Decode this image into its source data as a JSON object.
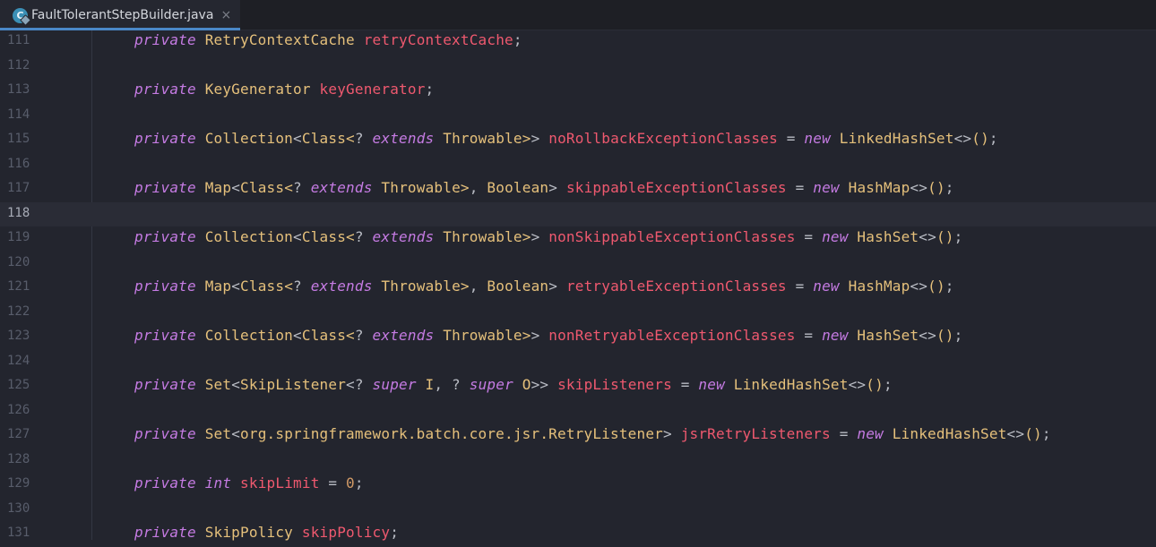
{
  "tab": {
    "title": "FaultTolerantStepBuilder.java",
    "close": "×",
    "icon_letter": "C"
  },
  "colors": {
    "keyword": "#c57be3",
    "type": "#e5c07b",
    "field": "#ef596f",
    "number": "#d19a66",
    "punct": "#b9bcc4",
    "background": "#23252e"
  },
  "editor": {
    "current_line": "118",
    "lines": [
      {
        "no": "111",
        "tokens": [
          [
            "kw",
            "private"
          ],
          [
            "pn",
            " "
          ],
          [
            "ty",
            "RetryContextCache"
          ],
          [
            "pn",
            " "
          ],
          [
            "fd",
            "retryContextCache"
          ],
          [
            "pn",
            ";"
          ]
        ]
      },
      {
        "no": "112",
        "tokens": []
      },
      {
        "no": "113",
        "tokens": [
          [
            "kw",
            "private"
          ],
          [
            "pn",
            " "
          ],
          [
            "ty",
            "KeyGenerator"
          ],
          [
            "pn",
            " "
          ],
          [
            "fd",
            "keyGenerator"
          ],
          [
            "pn",
            ";"
          ]
        ]
      },
      {
        "no": "114",
        "tokens": []
      },
      {
        "no": "115",
        "tokens": [
          [
            "kw",
            "private"
          ],
          [
            "pn",
            " "
          ],
          [
            "ty",
            "Collection"
          ],
          [
            "pn",
            "<"
          ],
          [
            "ty",
            "Class"
          ],
          [
            "gn",
            "<"
          ],
          [
            "pn",
            "? "
          ],
          [
            "kw",
            "extends"
          ],
          [
            "pn",
            " "
          ],
          [
            "ty",
            "Throwable"
          ],
          [
            "gn",
            ">"
          ],
          [
            "pn",
            "> "
          ],
          [
            "fd",
            "noRollbackExceptionClasses"
          ],
          [
            "pn",
            " = "
          ],
          [
            "kw",
            "new"
          ],
          [
            "pn",
            " "
          ],
          [
            "ty",
            "LinkedHashSet"
          ],
          [
            "pn",
            "<>"
          ],
          [
            "br",
            "()"
          ],
          [
            "pn",
            ";"
          ]
        ]
      },
      {
        "no": "116",
        "tokens": []
      },
      {
        "no": "117",
        "tokens": [
          [
            "kw",
            "private"
          ],
          [
            "pn",
            " "
          ],
          [
            "ty",
            "Map"
          ],
          [
            "pn",
            "<"
          ],
          [
            "ty",
            "Class"
          ],
          [
            "gn",
            "<"
          ],
          [
            "pn",
            "? "
          ],
          [
            "kw",
            "extends"
          ],
          [
            "pn",
            " "
          ],
          [
            "ty",
            "Throwable"
          ],
          [
            "gn",
            ">"
          ],
          [
            "pn",
            ", "
          ],
          [
            "ty",
            "Boolean"
          ],
          [
            "pn",
            "> "
          ],
          [
            "fd",
            "skippableExceptionClasses"
          ],
          [
            "pn",
            " = "
          ],
          [
            "kw",
            "new"
          ],
          [
            "pn",
            " "
          ],
          [
            "ty",
            "HashMap"
          ],
          [
            "pn",
            "<>"
          ],
          [
            "br",
            "()"
          ],
          [
            "pn",
            ";"
          ]
        ]
      },
      {
        "no": "118",
        "tokens": []
      },
      {
        "no": "119",
        "tokens": [
          [
            "kw",
            "private"
          ],
          [
            "pn",
            " "
          ],
          [
            "ty",
            "Collection"
          ],
          [
            "pn",
            "<"
          ],
          [
            "ty",
            "Class"
          ],
          [
            "gn",
            "<"
          ],
          [
            "pn",
            "? "
          ],
          [
            "kw",
            "extends"
          ],
          [
            "pn",
            " "
          ],
          [
            "ty",
            "Throwable"
          ],
          [
            "gn",
            ">"
          ],
          [
            "pn",
            "> "
          ],
          [
            "fd",
            "nonSkippableExceptionClasses"
          ],
          [
            "pn",
            " = "
          ],
          [
            "kw",
            "new"
          ],
          [
            "pn",
            " "
          ],
          [
            "ty",
            "HashSet"
          ],
          [
            "pn",
            "<>"
          ],
          [
            "br",
            "()"
          ],
          [
            "pn",
            ";"
          ]
        ]
      },
      {
        "no": "120",
        "tokens": []
      },
      {
        "no": "121",
        "tokens": [
          [
            "kw",
            "private"
          ],
          [
            "pn",
            " "
          ],
          [
            "ty",
            "Map"
          ],
          [
            "pn",
            "<"
          ],
          [
            "ty",
            "Class"
          ],
          [
            "gn",
            "<"
          ],
          [
            "pn",
            "? "
          ],
          [
            "kw",
            "extends"
          ],
          [
            "pn",
            " "
          ],
          [
            "ty",
            "Throwable"
          ],
          [
            "gn",
            ">"
          ],
          [
            "pn",
            ", "
          ],
          [
            "ty",
            "Boolean"
          ],
          [
            "pn",
            "> "
          ],
          [
            "fd",
            "retryableExceptionClasses"
          ],
          [
            "pn",
            " = "
          ],
          [
            "kw",
            "new"
          ],
          [
            "pn",
            " "
          ],
          [
            "ty",
            "HashMap"
          ],
          [
            "pn",
            "<>"
          ],
          [
            "br",
            "()"
          ],
          [
            "pn",
            ";"
          ]
        ]
      },
      {
        "no": "122",
        "tokens": []
      },
      {
        "no": "123",
        "tokens": [
          [
            "kw",
            "private"
          ],
          [
            "pn",
            " "
          ],
          [
            "ty",
            "Collection"
          ],
          [
            "pn",
            "<"
          ],
          [
            "ty",
            "Class"
          ],
          [
            "gn",
            "<"
          ],
          [
            "pn",
            "? "
          ],
          [
            "kw",
            "extends"
          ],
          [
            "pn",
            " "
          ],
          [
            "ty",
            "Throwable"
          ],
          [
            "gn",
            ">"
          ],
          [
            "pn",
            "> "
          ],
          [
            "fd",
            "nonRetryableExceptionClasses"
          ],
          [
            "pn",
            " = "
          ],
          [
            "kw",
            "new"
          ],
          [
            "pn",
            " "
          ],
          [
            "ty",
            "HashSet"
          ],
          [
            "pn",
            "<>"
          ],
          [
            "br",
            "()"
          ],
          [
            "pn",
            ";"
          ]
        ]
      },
      {
        "no": "124",
        "tokens": []
      },
      {
        "no": "125",
        "tokens": [
          [
            "kw",
            "private"
          ],
          [
            "pn",
            " "
          ],
          [
            "ty",
            "Set"
          ],
          [
            "pn",
            "<"
          ],
          [
            "ty",
            "SkipListener"
          ],
          [
            "pn",
            "<? "
          ],
          [
            "kw",
            "super"
          ],
          [
            "pn",
            " "
          ],
          [
            "ty",
            "I"
          ],
          [
            "pn",
            ", ? "
          ],
          [
            "kw",
            "super"
          ],
          [
            "pn",
            " "
          ],
          [
            "ty",
            "O"
          ],
          [
            "pn",
            ">> "
          ],
          [
            "fd",
            "skipListeners"
          ],
          [
            "pn",
            " = "
          ],
          [
            "kw",
            "new"
          ],
          [
            "pn",
            " "
          ],
          [
            "ty",
            "LinkedHashSet"
          ],
          [
            "pn",
            "<>"
          ],
          [
            "br",
            "()"
          ],
          [
            "pn",
            ";"
          ]
        ]
      },
      {
        "no": "126",
        "tokens": []
      },
      {
        "no": "127",
        "tokens": [
          [
            "kw",
            "private"
          ],
          [
            "pn",
            " "
          ],
          [
            "ty",
            "Set"
          ],
          [
            "pn",
            "<"
          ],
          [
            "ty",
            "org.springframework.batch.core.jsr.RetryListener"
          ],
          [
            "pn",
            "> "
          ],
          [
            "fd",
            "jsrRetryListeners"
          ],
          [
            "pn",
            " = "
          ],
          [
            "kw",
            "new"
          ],
          [
            "pn",
            " "
          ],
          [
            "ty",
            "LinkedHashSet"
          ],
          [
            "pn",
            "<>"
          ],
          [
            "br",
            "()"
          ],
          [
            "pn",
            ";"
          ]
        ]
      },
      {
        "no": "128",
        "tokens": []
      },
      {
        "no": "129",
        "tokens": [
          [
            "kw",
            "private"
          ],
          [
            "pn",
            " "
          ],
          [
            "kw",
            "int"
          ],
          [
            "pn",
            " "
          ],
          [
            "fd",
            "skipLimit"
          ],
          [
            "pn",
            " = "
          ],
          [
            "nm",
            "0"
          ],
          [
            "pn",
            ";"
          ]
        ]
      },
      {
        "no": "130",
        "tokens": []
      },
      {
        "no": "131",
        "tokens": [
          [
            "kw",
            "private"
          ],
          [
            "pn",
            " "
          ],
          [
            "ty",
            "SkipPolicy"
          ],
          [
            "pn",
            " "
          ],
          [
            "fd",
            "skipPolicy"
          ],
          [
            "pn",
            ";"
          ]
        ]
      }
    ]
  }
}
